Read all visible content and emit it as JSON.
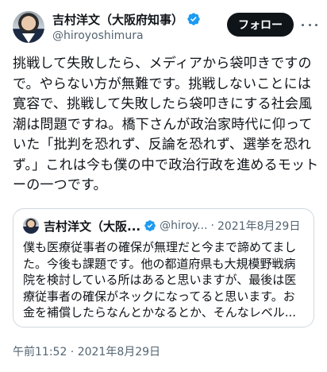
{
  "author": {
    "display_name": "吉村洋文（大阪府知事）",
    "handle": "@hiroyoshimura",
    "verified_icon": "verified-badge-icon"
  },
  "actions": {
    "follow_label": "フォロー",
    "more_icon": "more-options-icon"
  },
  "tweet": {
    "lines": [
      "挑戦して失敗したら、メディアから袋叩きですの",
      "で。やらない方が無難です。挑戦しないことには",
      "寛容で、挑戦して失敗したら袋叩きにする社会風",
      "潮は問題ですね。橋下さんが政治家時代に仰って",
      "いた「批判を恐れず、反論を恐れず、選挙を恐れ",
      "ず。」これは今も僕の中で政治行政を進めるモット",
      "ーの一つです。"
    ],
    "timestamp": "午前11:52 · 2021年8月29日"
  },
  "quoted_tweet": {
    "display_name": "吉村洋文（大阪...",
    "handle": "@hiroy...",
    "separator": "·",
    "date": "2021年8月29日",
    "lines": [
      "僕も医療従事者の確保が無理だと今まで諦めてまし",
      "た。今後も課題です。他の都道府県も大規模野戦病",
      "院を検討している所はあると思いますが、最後は医",
      "療従事者の確保がネックになってると思います。お",
      "金を補償したらなんとかなるとか、そんなレベル..."
    ]
  },
  "colors": {
    "verified_blue": "#1d9bf0",
    "text_primary": "#0f1419",
    "text_secondary": "#536471",
    "border": "#cfd9de",
    "follow_bg": "#0f1419"
  }
}
